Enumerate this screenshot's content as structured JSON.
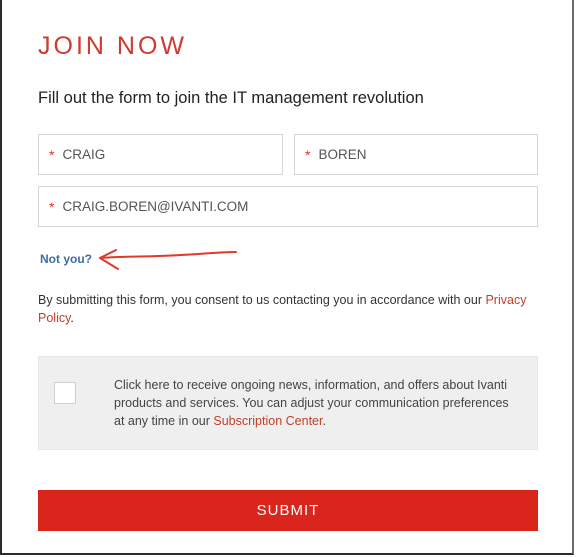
{
  "form": {
    "title": "JOIN NOW",
    "subtitle": "Fill out the form to join the IT management revolution",
    "first_name": {
      "required_mark": "*",
      "value": "CRAIG"
    },
    "last_name": {
      "required_mark": "*",
      "value": "BOREN"
    },
    "email": {
      "required_mark": "*",
      "value": "CRAIG.BOREN@IVANTI.COM"
    },
    "not_you_link": "Not you?",
    "consent_text": "By submitting this form, you consent to us contacting you in accordance with our",
    "privacy_link": "Privacy Policy",
    "consent_end": ".",
    "optin_text": "Click here to receive ongoing news, information, and offers about Ivanti products and services. You can adjust your communication preferences at any time in our",
    "subscription_link": "Subscription Center",
    "optin_end": ".",
    "optin_checked": false,
    "submit_label": "SUBMIT"
  },
  "annotation": {
    "arrow_color": "#e0392b"
  },
  "colors": {
    "accent": "#d9251c",
    "title": "#cf3a31",
    "link": "#3b6ea8"
  }
}
